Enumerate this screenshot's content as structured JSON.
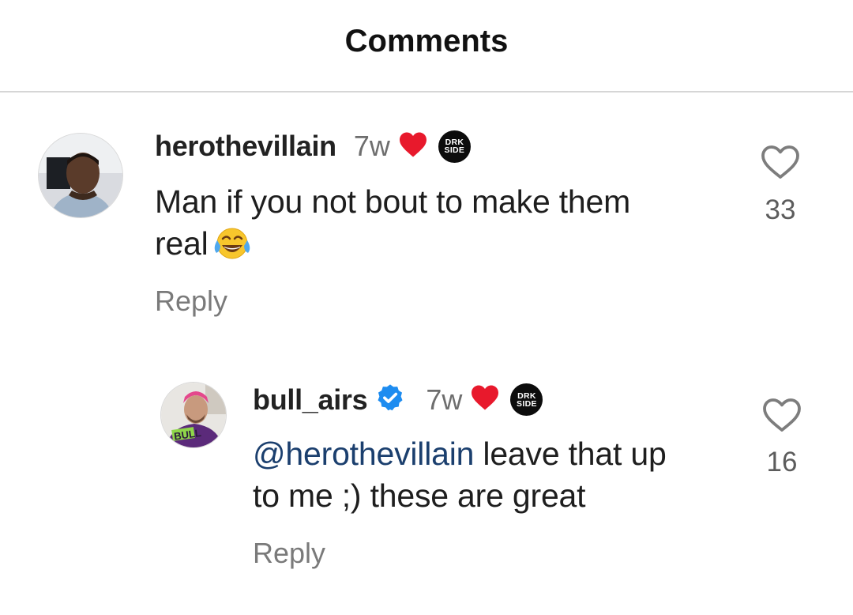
{
  "header": {
    "title": "Comments"
  },
  "comments": [
    {
      "username": "herothevillain",
      "time": "7w",
      "text_line1": "Man if you not bout to make them",
      "text_line2": "real",
      "reply_label": "Reply",
      "likes": "33",
      "creator_liked": true,
      "badge": {
        "line1": "DRK",
        "line2": "SIDE"
      }
    },
    {
      "username": "bull_airs",
      "verified": true,
      "time": "7w",
      "mention": "@herothevillain",
      "text_after_mention": " leave that up",
      "text_line2": "to me ;) these are great",
      "reply_label": "Reply",
      "likes": "16",
      "creator_liked": true,
      "badge": {
        "line1": "DRK",
        "line2": "SIDE"
      }
    }
  ],
  "colors": {
    "heart_red": "#e8192c",
    "verified_blue": "#1d8cf0",
    "mention_blue": "#1b3f6e",
    "meta_gray": "#6e6e6e"
  },
  "icons": {
    "like": "heart-outline-icon",
    "creator_like": "heart-filled-icon",
    "verified": "verified-badge-icon",
    "emoji": "face-with-tears-of-joy-emoji"
  }
}
